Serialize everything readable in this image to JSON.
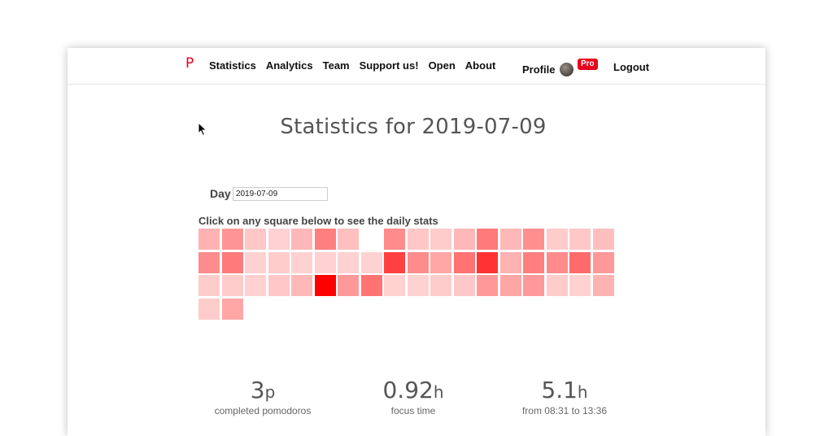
{
  "nav": {
    "logo": "P",
    "links": [
      "Statistics",
      "Analytics",
      "Team",
      "Support us!",
      "Open",
      "About"
    ],
    "profile_label": "Profile",
    "pro_badge": "Pro",
    "logout_label": "Logout"
  },
  "page": {
    "title": "Statistics for 2019-07-09"
  },
  "day": {
    "label": "Day",
    "value": "2019-07-09"
  },
  "calendar": {
    "instruction": "Click on any square below to see the daily stats",
    "columns": 18,
    "cells": [
      0.3,
      0.42,
      0.22,
      0.18,
      0.28,
      0.5,
      0.25,
      null,
      0.45,
      0.22,
      0.2,
      0.28,
      0.52,
      0.28,
      0.44,
      0.2,
      0.22,
      0.25,
      0.45,
      0.52,
      0.18,
      0.2,
      0.18,
      0.18,
      0.18,
      0.18,
      0.75,
      0.45,
      0.35,
      0.55,
      0.8,
      0.3,
      0.5,
      0.45,
      0.58,
      0.4,
      0.2,
      0.2,
      0.18,
      0.22,
      0.28,
      1.0,
      0.4,
      0.55,
      0.18,
      0.18,
      0.2,
      0.22,
      0.4,
      0.35,
      0.4,
      0.2,
      0.18,
      0.3,
      0.2,
      0.35
    ],
    "base_color": "#ff0000"
  },
  "stats": [
    {
      "value": "3",
      "unit": "p",
      "caption": "completed pomodoros"
    },
    {
      "value": "0.92",
      "unit": "h",
      "caption": "focus time"
    },
    {
      "value": "5.1",
      "unit": "h",
      "caption": "from 08:31 to 13:36"
    }
  ],
  "colors": {
    "accent": "#e8001c"
  }
}
